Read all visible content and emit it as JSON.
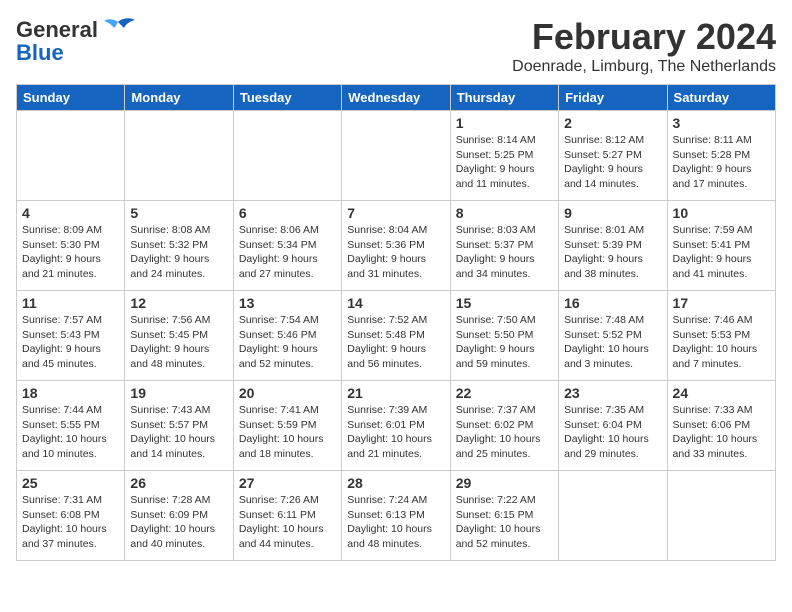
{
  "header": {
    "logo_general": "General",
    "logo_blue": "Blue",
    "month_title": "February 2024",
    "location": "Doenrade, Limburg, The Netherlands"
  },
  "weekdays": [
    "Sunday",
    "Monday",
    "Tuesday",
    "Wednesday",
    "Thursday",
    "Friday",
    "Saturday"
  ],
  "weeks": [
    [
      {
        "day": "",
        "info": ""
      },
      {
        "day": "",
        "info": ""
      },
      {
        "day": "",
        "info": ""
      },
      {
        "day": "",
        "info": ""
      },
      {
        "day": "1",
        "info": "Sunrise: 8:14 AM\nSunset: 5:25 PM\nDaylight: 9 hours\nand 11 minutes."
      },
      {
        "day": "2",
        "info": "Sunrise: 8:12 AM\nSunset: 5:27 PM\nDaylight: 9 hours\nand 14 minutes."
      },
      {
        "day": "3",
        "info": "Sunrise: 8:11 AM\nSunset: 5:28 PM\nDaylight: 9 hours\nand 17 minutes."
      }
    ],
    [
      {
        "day": "4",
        "info": "Sunrise: 8:09 AM\nSunset: 5:30 PM\nDaylight: 9 hours\nand 21 minutes."
      },
      {
        "day": "5",
        "info": "Sunrise: 8:08 AM\nSunset: 5:32 PM\nDaylight: 9 hours\nand 24 minutes."
      },
      {
        "day": "6",
        "info": "Sunrise: 8:06 AM\nSunset: 5:34 PM\nDaylight: 9 hours\nand 27 minutes."
      },
      {
        "day": "7",
        "info": "Sunrise: 8:04 AM\nSunset: 5:36 PM\nDaylight: 9 hours\nand 31 minutes."
      },
      {
        "day": "8",
        "info": "Sunrise: 8:03 AM\nSunset: 5:37 PM\nDaylight: 9 hours\nand 34 minutes."
      },
      {
        "day": "9",
        "info": "Sunrise: 8:01 AM\nSunset: 5:39 PM\nDaylight: 9 hours\nand 38 minutes."
      },
      {
        "day": "10",
        "info": "Sunrise: 7:59 AM\nSunset: 5:41 PM\nDaylight: 9 hours\nand 41 minutes."
      }
    ],
    [
      {
        "day": "11",
        "info": "Sunrise: 7:57 AM\nSunset: 5:43 PM\nDaylight: 9 hours\nand 45 minutes."
      },
      {
        "day": "12",
        "info": "Sunrise: 7:56 AM\nSunset: 5:45 PM\nDaylight: 9 hours\nand 48 minutes."
      },
      {
        "day": "13",
        "info": "Sunrise: 7:54 AM\nSunset: 5:46 PM\nDaylight: 9 hours\nand 52 minutes."
      },
      {
        "day": "14",
        "info": "Sunrise: 7:52 AM\nSunset: 5:48 PM\nDaylight: 9 hours\nand 56 minutes."
      },
      {
        "day": "15",
        "info": "Sunrise: 7:50 AM\nSunset: 5:50 PM\nDaylight: 9 hours\nand 59 minutes."
      },
      {
        "day": "16",
        "info": "Sunrise: 7:48 AM\nSunset: 5:52 PM\nDaylight: 10 hours\nand 3 minutes."
      },
      {
        "day": "17",
        "info": "Sunrise: 7:46 AM\nSunset: 5:53 PM\nDaylight: 10 hours\nand 7 minutes."
      }
    ],
    [
      {
        "day": "18",
        "info": "Sunrise: 7:44 AM\nSunset: 5:55 PM\nDaylight: 10 hours\nand 10 minutes."
      },
      {
        "day": "19",
        "info": "Sunrise: 7:43 AM\nSunset: 5:57 PM\nDaylight: 10 hours\nand 14 minutes."
      },
      {
        "day": "20",
        "info": "Sunrise: 7:41 AM\nSunset: 5:59 PM\nDaylight: 10 hours\nand 18 minutes."
      },
      {
        "day": "21",
        "info": "Sunrise: 7:39 AM\nSunset: 6:01 PM\nDaylight: 10 hours\nand 21 minutes."
      },
      {
        "day": "22",
        "info": "Sunrise: 7:37 AM\nSunset: 6:02 PM\nDaylight: 10 hours\nand 25 minutes."
      },
      {
        "day": "23",
        "info": "Sunrise: 7:35 AM\nSunset: 6:04 PM\nDaylight: 10 hours\nand 29 minutes."
      },
      {
        "day": "24",
        "info": "Sunrise: 7:33 AM\nSunset: 6:06 PM\nDaylight: 10 hours\nand 33 minutes."
      }
    ],
    [
      {
        "day": "25",
        "info": "Sunrise: 7:31 AM\nSunset: 6:08 PM\nDaylight: 10 hours\nand 37 minutes."
      },
      {
        "day": "26",
        "info": "Sunrise: 7:28 AM\nSunset: 6:09 PM\nDaylight: 10 hours\nand 40 minutes."
      },
      {
        "day": "27",
        "info": "Sunrise: 7:26 AM\nSunset: 6:11 PM\nDaylight: 10 hours\nand 44 minutes."
      },
      {
        "day": "28",
        "info": "Sunrise: 7:24 AM\nSunset: 6:13 PM\nDaylight: 10 hours\nand 48 minutes."
      },
      {
        "day": "29",
        "info": "Sunrise: 7:22 AM\nSunset: 6:15 PM\nDaylight: 10 hours\nand 52 minutes."
      },
      {
        "day": "",
        "info": ""
      },
      {
        "day": "",
        "info": ""
      }
    ]
  ]
}
